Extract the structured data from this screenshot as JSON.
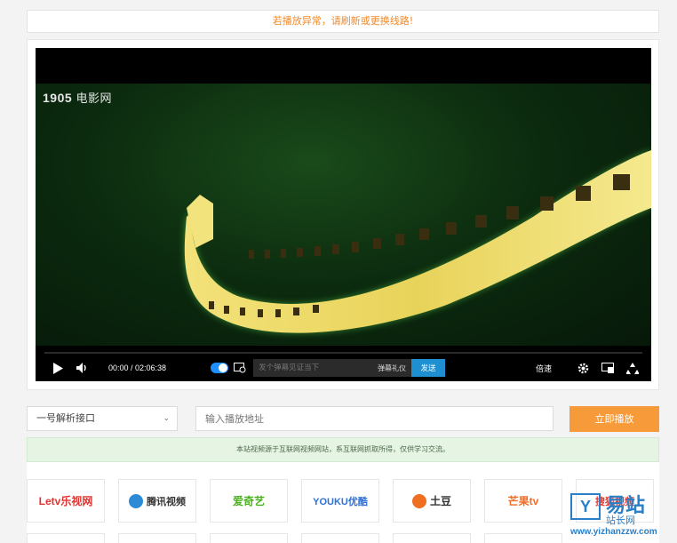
{
  "notice": "若播放异常，请刷新或更换线路!",
  "player": {
    "watermark_num": "1905",
    "watermark_brand": "电影网",
    "time": "00:00 / 02:06:38",
    "danmaku_placeholder": "发个弹幕见证当下",
    "danmaku_etiquette": "弹幕礼仪",
    "send": "发送",
    "speed": "倍速",
    "progress": 0
  },
  "form": {
    "select_value": "一号解析接口",
    "url_placeholder": "输入播放地址",
    "play_button": "立即播放"
  },
  "disclaimer": "本站视频源于互联网视频网站，系互联网抓取所得，仅供学习交流。",
  "platforms": [
    {
      "name": "Letv乐视网",
      "color": "#e0332f"
    },
    {
      "name": "腾讯视频",
      "color": "#2b8bd6"
    },
    {
      "name": "爱奇艺",
      "color": "#4caf1f"
    },
    {
      "name": "YOUKU优酷",
      "color": "#2f71d6"
    },
    {
      "name": "土豆",
      "color": "#ef6f20"
    },
    {
      "name": "芒果tv",
      "color": "#f46c24"
    },
    {
      "name": "搜狐视频",
      "color": "#e23b2f"
    }
  ],
  "corner_logo": {
    "big": "易站",
    "small": "站长网",
    "url": "www.yizhanzzw.com"
  }
}
